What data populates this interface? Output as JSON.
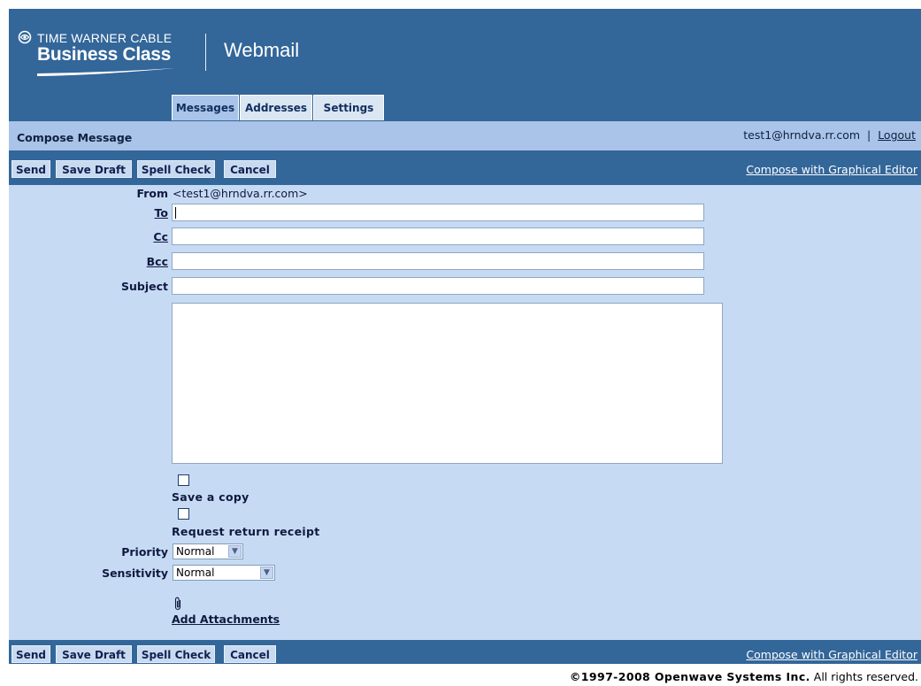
{
  "brand": {
    "company_top": "TIME WARNER CABLE",
    "company_main": "Business Class",
    "product": "Webmail"
  },
  "tabs": [
    {
      "label": "Messages",
      "active": true
    },
    {
      "label": "Addresses",
      "active": false
    },
    {
      "label": "Settings",
      "active": false
    }
  ],
  "titlebar": {
    "title": "Compose Message",
    "user": "test1@hrndva.rr.com",
    "separator": "|",
    "logout": "Logout"
  },
  "toolbar": {
    "send": "Send",
    "save_draft": "Save Draft",
    "spell_check": "Spell Check",
    "cancel": "Cancel",
    "graphical_editor": "Compose with Graphical Editor"
  },
  "form": {
    "from_label": "From",
    "from_value": "<test1@hrndva.rr.com>",
    "to_label": "To",
    "to_value": "",
    "cc_label": "Cc",
    "cc_value": "",
    "bcc_label": "Bcc",
    "bcc_value": "",
    "subject_label": "Subject",
    "subject_value": "",
    "body_value": "",
    "save_copy_label": "Save a copy",
    "save_copy_checked": false,
    "return_receipt_label": "Request return receipt",
    "return_receipt_checked": false,
    "priority_label": "Priority",
    "priority_value": "Normal",
    "sensitivity_label": "Sensitivity",
    "sensitivity_value": "Normal",
    "add_attachments": "Add Attachments"
  },
  "footer": {
    "copyright_bold": "©1997-2008 Openwave Systems Inc.",
    "rights": "All rights reserved."
  },
  "colors": {
    "frame_blue": "#336699",
    "title_bar": "#a9c4e8",
    "form_bg": "#c6dbf3",
    "button_bg": "#c8daf0"
  }
}
